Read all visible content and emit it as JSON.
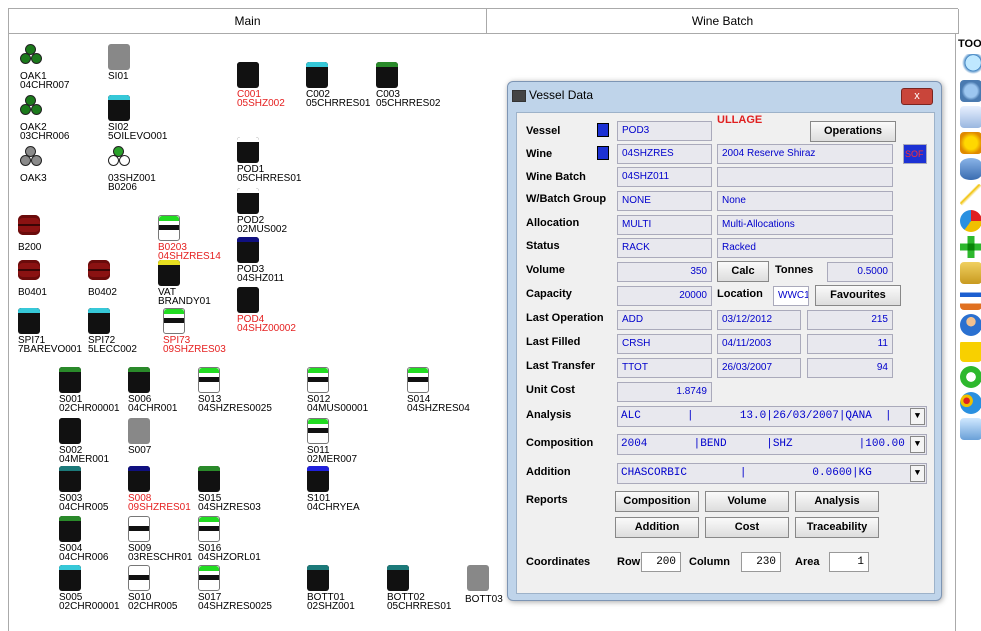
{
  "tabs": {
    "main": "Main",
    "wine_batch": "Wine Batch"
  },
  "toolbar": {
    "title": "TOO"
  },
  "vessels": [
    {
      "id": "oak1",
      "l": [
        "OAK1",
        "04CHR007"
      ],
      "kind": "clover",
      "color": "#1b7a1b"
    },
    {
      "id": "si01",
      "l": [
        "SI01"
      ],
      "kind": "grey"
    },
    {
      "id": "oak2",
      "l": [
        "OAK2",
        "03CHR006"
      ],
      "kind": "clover",
      "color": "#1b7a1b"
    },
    {
      "id": "si02",
      "l": [
        "SI02",
        "5OILEVO001"
      ],
      "kind": "tank",
      "top": "#36c8d8"
    },
    {
      "id": "oak3",
      "l": [
        "OAK3"
      ],
      "kind": "clover",
      "color": "#8a8a8a"
    },
    {
      "id": "z03shz",
      "l": [
        "03SHZ001",
        "B0206"
      ],
      "kind": "clover",
      "color": "#2aa02a",
      "hollow": true
    },
    {
      "id": "c001",
      "l": [
        "C001",
        "05SHZ002"
      ],
      "kind": "tank",
      "top": "#111",
      "red": true
    },
    {
      "id": "c002",
      "l": [
        "C002",
        "05CHRRES01"
      ],
      "kind": "tank",
      "top": "#36c8d8"
    },
    {
      "id": "c003",
      "l": [
        "C003",
        "05CHRRES02"
      ],
      "kind": "tank",
      "top": "#2a8a2a"
    },
    {
      "id": "pod1",
      "l": [
        "POD1",
        "05CHRRES01"
      ],
      "kind": "tank",
      "top": "#fff"
    },
    {
      "id": "pod2",
      "l": [
        "POD2",
        "02MUS002"
      ],
      "kind": "tank",
      "top": "#fff"
    },
    {
      "id": "pod3",
      "l": [
        "POD3",
        "04SHZ011"
      ],
      "kind": "tank",
      "top": "#101080"
    },
    {
      "id": "pod4",
      "l": [
        "POD4",
        "04SHZ00002"
      ],
      "kind": "tank",
      "top": "#111",
      "red": true
    },
    {
      "id": "b200",
      "l": [
        "B200"
      ],
      "kind": "barrel"
    },
    {
      "id": "b0203",
      "l": [
        "B0203",
        "04SHZRES14"
      ],
      "kind": "light",
      "top": "#22dd22",
      "red": true
    },
    {
      "id": "b0401",
      "l": [
        "B0401"
      ],
      "kind": "barrel"
    },
    {
      "id": "b0402",
      "l": [
        "B0402"
      ],
      "kind": "barrel"
    },
    {
      "id": "vat",
      "l": [
        "VAT",
        "BRANDY01"
      ],
      "kind": "tank",
      "top": "#e8e020"
    },
    {
      "id": "spi71",
      "l": [
        "SPI71",
        "7BAREVO001"
      ],
      "kind": "tank",
      "top": "#36c8d8"
    },
    {
      "id": "spi72",
      "l": [
        "SPI72",
        "5LECC002"
      ],
      "kind": "tank",
      "top": "#36c8d8"
    },
    {
      "id": "spi73",
      "l": [
        "SPI73",
        "09SHZRES03"
      ],
      "kind": "light",
      "top": "#22dd22",
      "red": true
    },
    {
      "id": "s001",
      "l": [
        "S001",
        "02CHR00001"
      ],
      "kind": "tank",
      "top": "#2a8a2a"
    },
    {
      "id": "s006",
      "l": [
        "S006",
        "04CHR001"
      ],
      "kind": "tank",
      "top": "#2a8a2a"
    },
    {
      "id": "s013",
      "l": [
        "S013",
        "04SHZRES0025"
      ],
      "kind": "light",
      "top": "#22dd22"
    },
    {
      "id": "s012",
      "l": [
        "S012",
        "04MUS00001"
      ],
      "kind": "light",
      "top": "#22dd22"
    },
    {
      "id": "s014",
      "l": [
        "S014",
        "04SHZRES04"
      ],
      "kind": "light",
      "top": "#22dd22"
    },
    {
      "id": "s002",
      "l": [
        "S002",
        "04MER001"
      ],
      "kind": "tank",
      "top": "#111"
    },
    {
      "id": "s007",
      "l": [
        "S007"
      ],
      "kind": "grey"
    },
    {
      "id": "s011",
      "l": [
        "S011",
        "02MER007"
      ],
      "kind": "light",
      "top": "#22dd22"
    },
    {
      "id": "s003",
      "l": [
        "S003",
        "04CHR005"
      ],
      "kind": "tank",
      "top": "#1c7a7a"
    },
    {
      "id": "s008",
      "l": [
        "S008",
        "09SHZRES01"
      ],
      "kind": "tank",
      "top": "#101080",
      "red": true
    },
    {
      "id": "s015",
      "l": [
        "S015",
        "04SHZRES03"
      ],
      "kind": "tank",
      "top": "#2a8a2a"
    },
    {
      "id": "s101",
      "l": [
        "S101",
        "04CHRYEA"
      ],
      "kind": "tank",
      "top": "#2020dd"
    },
    {
      "id": "s004",
      "l": [
        "S004",
        "04CHR006"
      ],
      "kind": "tank",
      "top": "#2a8a2a"
    },
    {
      "id": "s009",
      "l": [
        "S009",
        "03RESCHR01"
      ],
      "kind": "light",
      "top": "#fff"
    },
    {
      "id": "s016",
      "l": [
        "S016",
        "04SHZORL01"
      ],
      "kind": "light",
      "top": "#22dd22"
    },
    {
      "id": "s005",
      "l": [
        "S005",
        "02CHR00001"
      ],
      "kind": "tank",
      "top": "#36c8d8"
    },
    {
      "id": "s010",
      "l": [
        "S010",
        "02CHR005"
      ],
      "kind": "light",
      "top": "#fff"
    },
    {
      "id": "s017",
      "l": [
        "S017",
        "04SHZRES0025"
      ],
      "kind": "light",
      "top": "#22dd22"
    },
    {
      "id": "bott01",
      "l": [
        "BOTT01",
        "02SHZ001"
      ],
      "kind": "tank",
      "top": "#1c7a7a"
    },
    {
      "id": "bott02",
      "l": [
        "BOTT02",
        "05CHRRES01"
      ],
      "kind": "tank",
      "top": "#1c7a7a"
    },
    {
      "id": "bott03",
      "l": [
        "BOTT03"
      ],
      "kind": "grey",
      "labelRight": true
    }
  ],
  "dialog": {
    "title": "Vessel Data",
    "close": "x",
    "labels": {
      "vessel": "Vessel",
      "wine": "Wine",
      "wine_batch": "Wine Batch",
      "wbatch_group": "W/Batch Group",
      "allocation": "Allocation",
      "status": "Status",
      "volume": "Volume",
      "capacity": "Capacity",
      "last_operation": "Last Operation",
      "last_filled": "Last Filled",
      "last_transfer": "Last Transfer",
      "unit_cost": "Unit Cost",
      "analysis": "Analysis",
      "composition": "Composition",
      "addition": "Addition",
      "reports": "Reports",
      "coordinates": "Coordinates",
      "tonnes": "Tonnes",
      "location": "Location",
      "row": "Row",
      "column": "Column",
      "area": "Area"
    },
    "ullage": "ULLAGE",
    "vessel": "POD3",
    "wine_code": "04SHZRES",
    "wine_name": "2004 Reserve Shiraz",
    "sof": "SOF",
    "wine_batch": "04SHZ011",
    "wine_batch_desc": "",
    "wbatch_group": "NONE",
    "wbatch_group_desc": "None",
    "allocation": "MULTI",
    "allocation_desc": "Multi-Allocations",
    "status": "RACK",
    "status_desc": "Racked",
    "volume": "350",
    "tonnes": "0.5000",
    "capacity": "20000",
    "location": "WWC1",
    "last_operation": [
      "ADD",
      "03/12/2012",
      "215"
    ],
    "last_filled": [
      "CRSH",
      "04/11/2003",
      "11"
    ],
    "last_transfer": [
      "TTOT",
      "26/03/2007",
      "94"
    ],
    "unit_cost": "1.8749",
    "analysis": "ALC       |       13.0|26/03/2007|QANA  |",
    "composition": "2004       |BEND      |SHZ          |100.00",
    "addition": "CHASCORBIC        |          0.0600|KG",
    "buttons": {
      "operations": "Operations",
      "calc": "Calc",
      "favourites": "Favourites",
      "composition": "Composition",
      "volume": "Volume",
      "analysis": "Analysis",
      "addition": "Addition",
      "cost": "Cost",
      "traceability": "Traceability"
    },
    "row": "200",
    "column": "230",
    "area": "1"
  }
}
